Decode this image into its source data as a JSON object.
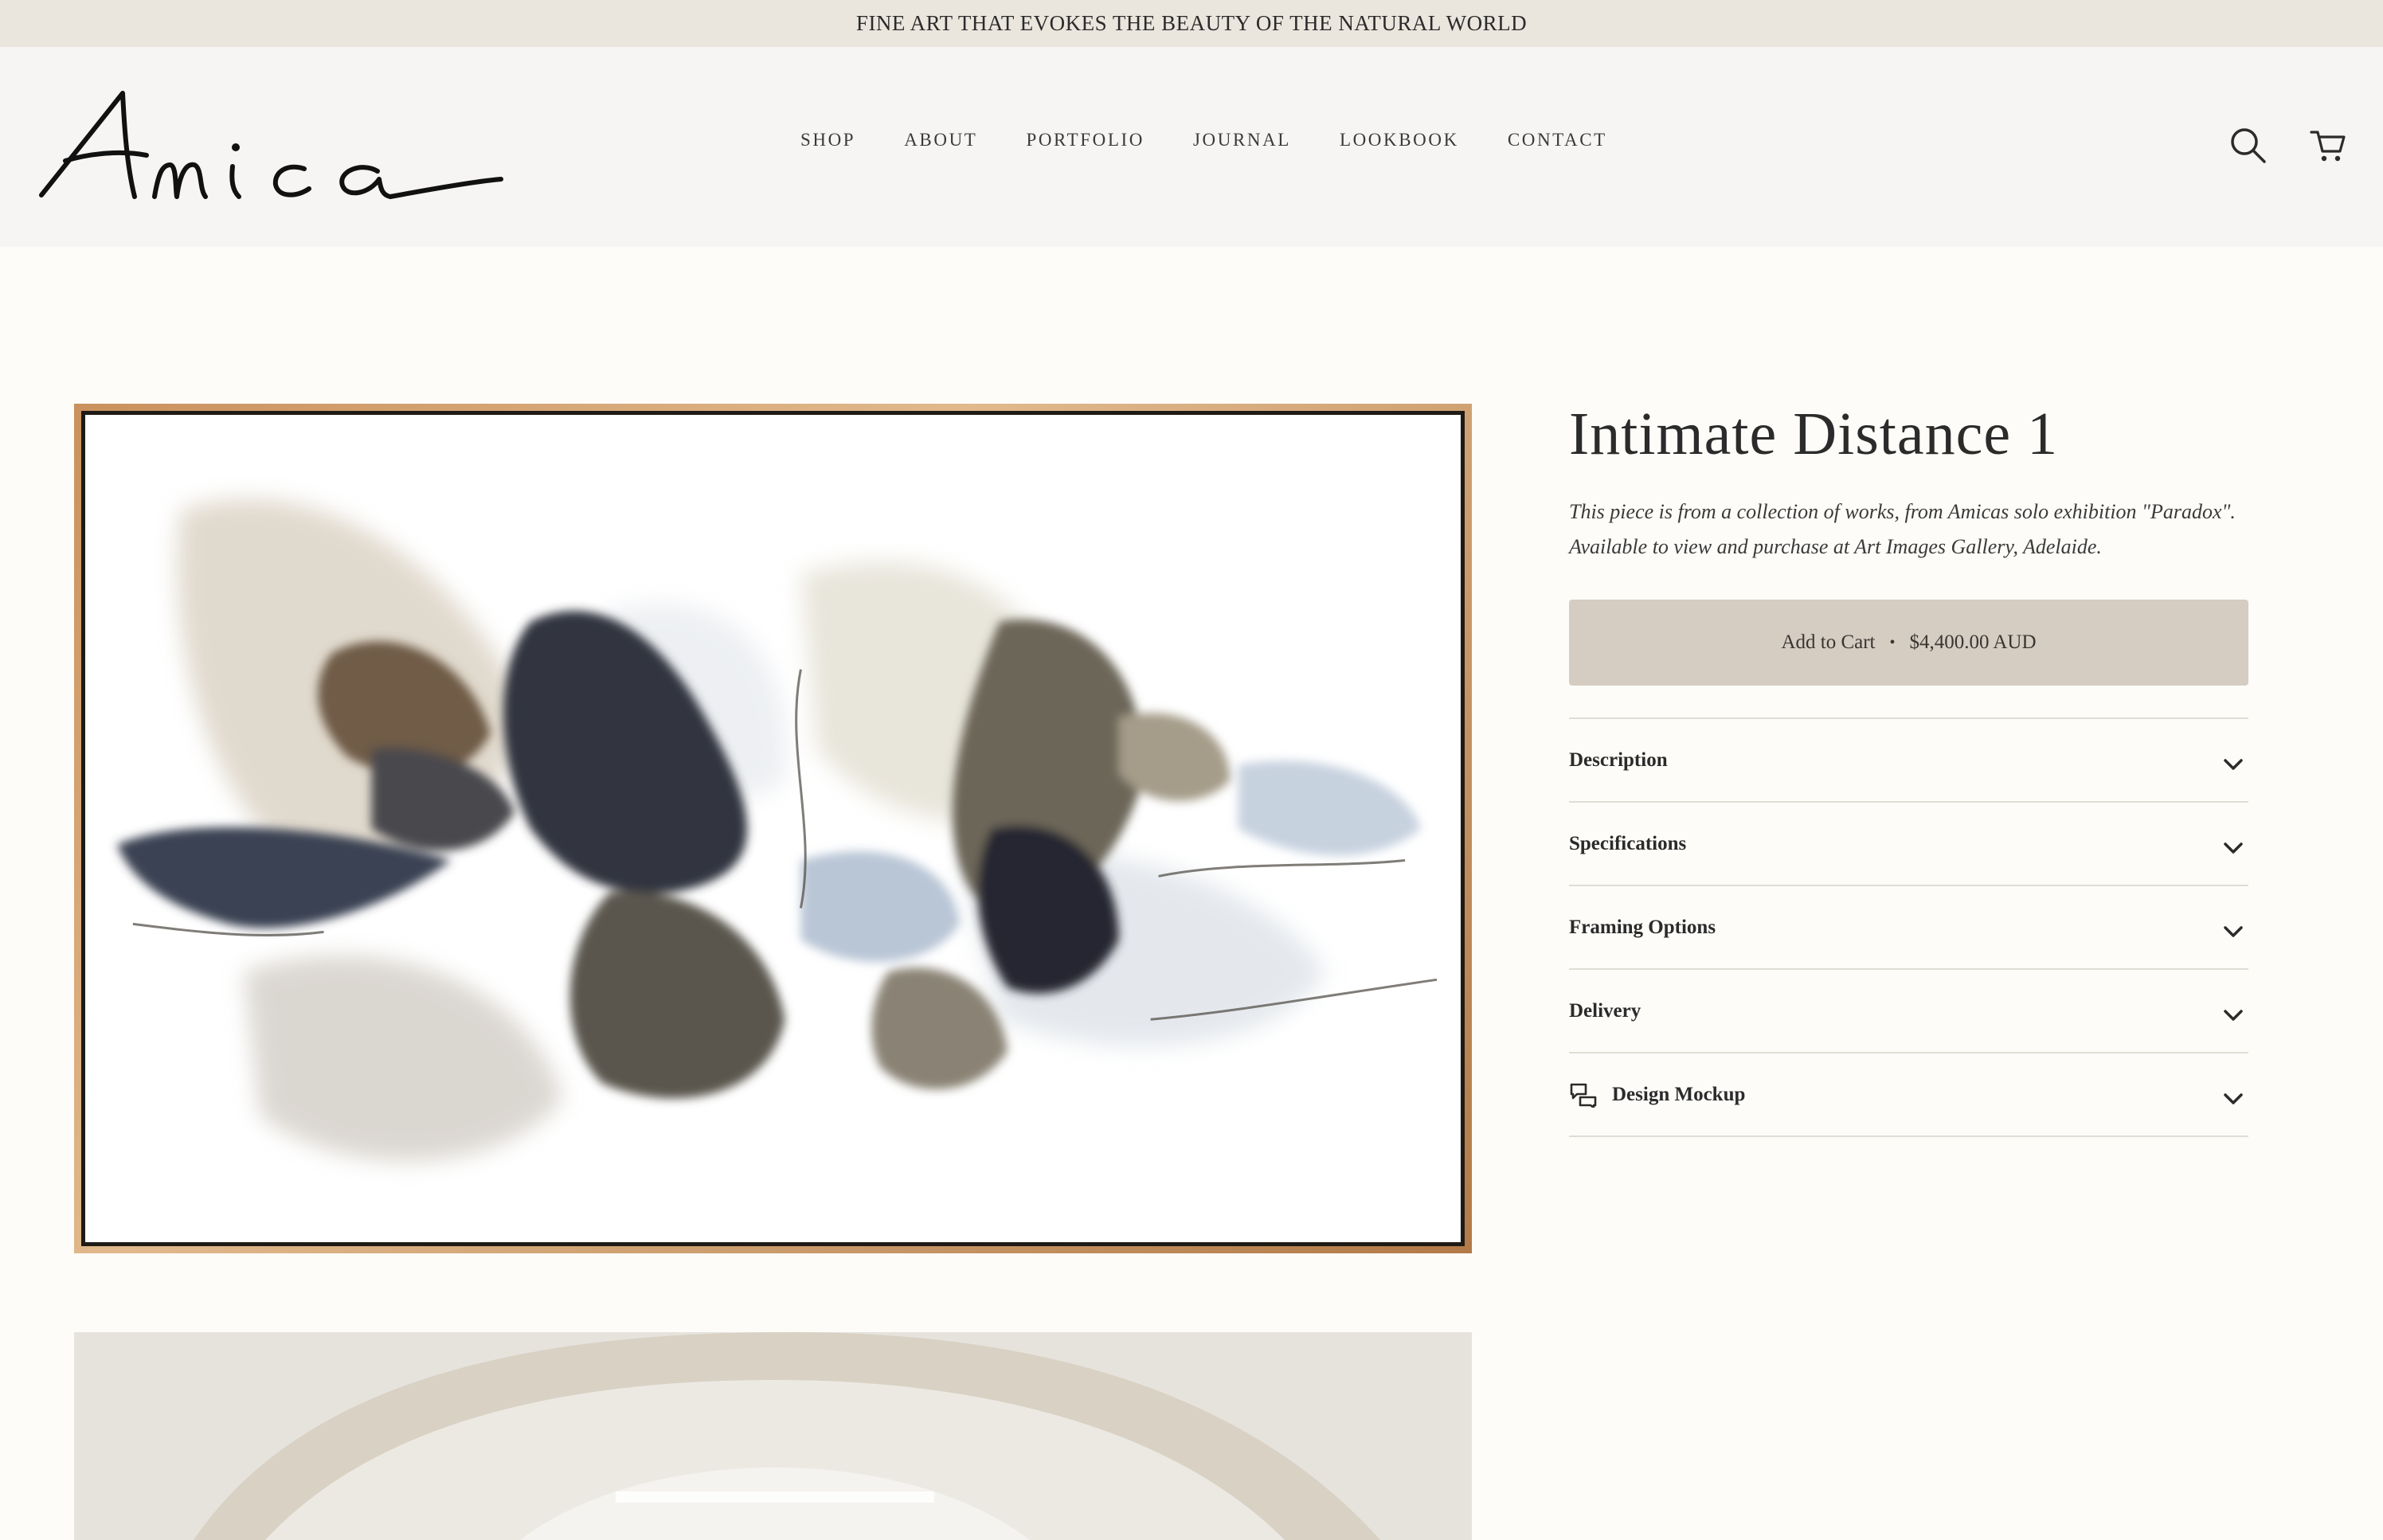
{
  "announcement": "FINE ART THAT EVOKES THE BEAUTY OF THE NATURAL WORLD",
  "brand": {
    "logo_text": "Amica"
  },
  "nav": [
    "SHOP",
    "ABOUT",
    "PORTFOLIO",
    "JOURNAL",
    "LOOKBOOK",
    "CONTACT"
  ],
  "icons": {
    "search": "search-icon",
    "cart": "cart-icon",
    "chevron": "chevron-down-icon",
    "mockup": "chat-bubbles-icon"
  },
  "product": {
    "title": "Intimate Distance 1",
    "description_line1": "This piece is from a collection of works, from Amicas solo exhibition \"Paradox\".",
    "description_line2": "Available to view and purchase at Art Images Gallery, Adelaide.",
    "add_to_cart": "Add to Cart",
    "separator": "•",
    "price": "$4,400.00 AUD"
  },
  "accordion": [
    "Description",
    "Specifications",
    "Framing Options",
    "Delivery",
    "Design Mockup"
  ],
  "colors": {
    "announcement_bg": "#ebe6dd",
    "header_bg": "#f6f5f3",
    "page_bg": "#fdfcf8",
    "button_bg": "#d5ccc2",
    "frame": "#d9a672"
  }
}
